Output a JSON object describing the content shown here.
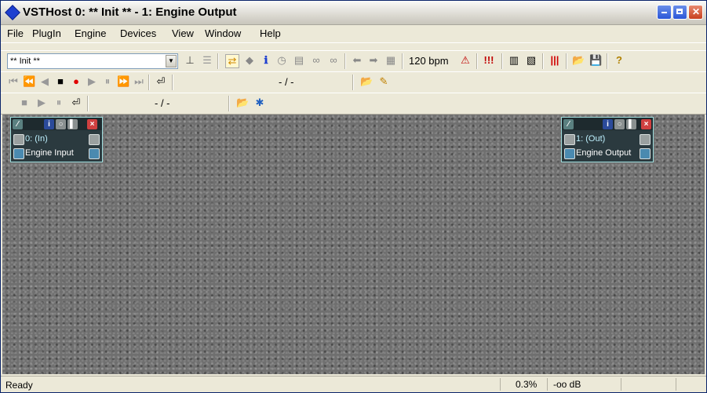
{
  "window": {
    "title": "VSTHost 0: ** Init ** - 1: Engine Output"
  },
  "menubar": {
    "items": [
      "File",
      "PlugIn",
      "Engine",
      "Devices",
      "View",
      "Window",
      "Help"
    ]
  },
  "toolbar": {
    "performance_value": "** Init **",
    "bpm": "120 bpm",
    "position_display": "- / -",
    "player_position_display": "- / -"
  },
  "plugins": {
    "input": {
      "line1": "0: (In)",
      "line2": "Engine Input"
    },
    "output": {
      "line1": "1: (Out)",
      "line2": "Engine Output"
    }
  },
  "statusbar": {
    "text": "Ready",
    "cpu": "0.3%",
    "level": "-oo dB"
  },
  "colors": {
    "accent": "#1e3fd0",
    "record": "#e00000",
    "workspace": "#6f6f6f",
    "plugin_border": "#9edcdc"
  }
}
